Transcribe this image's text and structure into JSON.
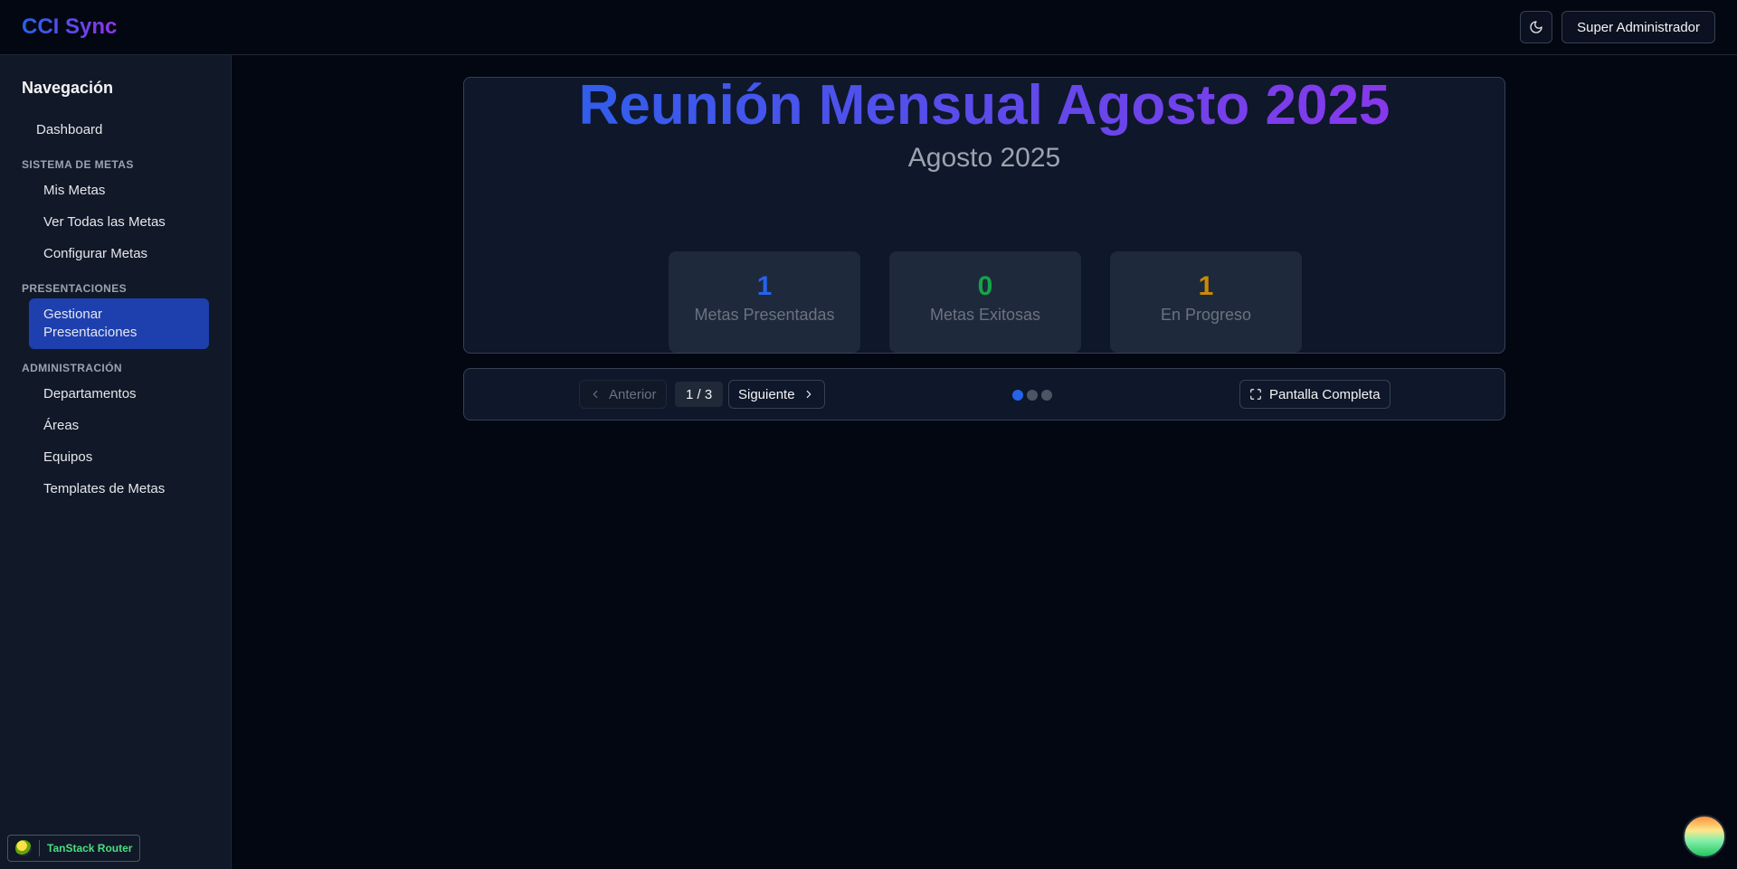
{
  "header": {
    "brand": "CCI Sync",
    "user_label": "Super Administrador",
    "theme_icon": "moon-icon"
  },
  "sidebar": {
    "title": "Navegación",
    "dashboard": "Dashboard",
    "sections": [
      {
        "label": "SISTEMA DE METAS",
        "items": [
          "Mis Metas",
          "Ver Todas las Metas",
          "Configurar Metas"
        ]
      },
      {
        "label": "PRESENTACIONES",
        "items": [
          "Gestionar Presentaciones"
        ]
      },
      {
        "label": "ADMINISTRACIÓN",
        "items": [
          "Departamentos",
          "Áreas",
          "Equipos",
          "Templates de Metas"
        ]
      }
    ],
    "active_item": "Gestionar Presentaciones",
    "router_badge": "TanStack Router"
  },
  "slide": {
    "title": "Reunión Mensual Agosto 2025",
    "subtitle": "Agosto 2025",
    "stats": [
      {
        "value": "1",
        "label": "Metas Presentadas",
        "color": "#2563eb"
      },
      {
        "value": "0",
        "label": "Metas Exitosas",
        "color": "#16a34a"
      },
      {
        "value": "1",
        "label": "En Progreso",
        "color": "#ca8a04"
      }
    ]
  },
  "controls": {
    "prev_label": "Anterior",
    "page_indicator": "1 / 3",
    "next_label": "Siguiente",
    "fullscreen_label": "Pantalla Completa",
    "current_slide": 1,
    "total_slides": 3
  },
  "colors": {
    "accent": "#1e40af",
    "gradient_start": "#2563eb",
    "gradient_end": "#9333ea"
  }
}
